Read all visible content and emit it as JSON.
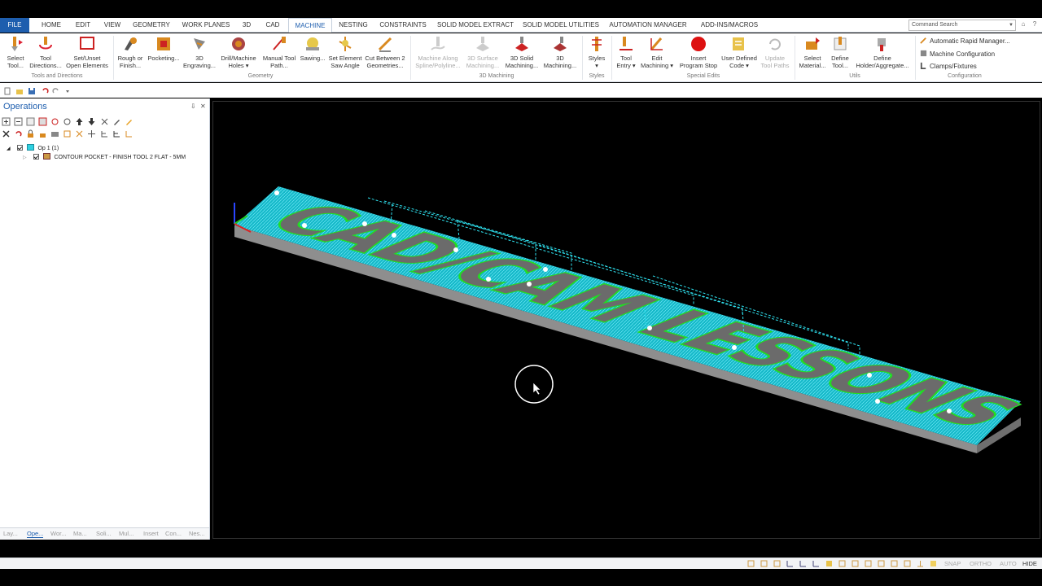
{
  "menu_tabs": [
    "FILE",
    "HOME",
    "EDIT",
    "VIEW",
    "GEOMETRY",
    "WORK PLANES",
    "3D",
    "CAD",
    "MACHINE",
    "NESTING",
    "CONSTRAINTS",
    "SOLID MODEL EXTRACT",
    "SOLID MODEL UTILITIES",
    "AUTOMATION MANAGER",
    "ADD-INS/MACROS"
  ],
  "active_tab": "MACHINE",
  "command_search": {
    "placeholder": "Command Search"
  },
  "ribbon": {
    "buttons": [
      {
        "l1": "Select",
        "l2": "Tool...",
        "icon": "select-tool-icon"
      },
      {
        "l1": "Tool",
        "l2": "Directions...",
        "icon": "tool-directions-icon"
      },
      {
        "l1": "Set/Unset",
        "l2": "Open Elements",
        "icon": "open-elements-icon"
      },
      {
        "l1": "Rough or",
        "l2": "Finish...",
        "icon": "rough-finish-icon"
      },
      {
        "l1": "Pocketing...",
        "l2": "",
        "icon": "pocketing-icon"
      },
      {
        "l1": "3D",
        "l2": "Engraving...",
        "icon": "engraving-icon"
      },
      {
        "l1": "Drill/Machine",
        "l2": "Holes ▾",
        "icon": "drill-icon"
      },
      {
        "l1": "Manual Tool",
        "l2": "Path...",
        "icon": "manual-path-icon"
      },
      {
        "l1": "Sawing...",
        "l2": "",
        "icon": "sawing-icon"
      },
      {
        "l1": "Set Element",
        "l2": "Saw Angle",
        "icon": "saw-angle-icon"
      },
      {
        "l1": "Cut Between 2",
        "l2": "Geometries...",
        "icon": "cut-between-icon"
      },
      {
        "l1": "Machine Along",
        "l2": "Spline/Polyline...",
        "icon": "machine-along-icon",
        "disabled": true
      },
      {
        "l1": "3D Surface",
        "l2": "Machining...",
        "icon": "surface-machining-icon",
        "disabled": true
      },
      {
        "l1": "3D Solid",
        "l2": "Machining...",
        "icon": "solid-machining-icon"
      },
      {
        "l1": "3D",
        "l2": "Machining...",
        "icon": "3d-machining-icon"
      },
      {
        "l1": "Styles",
        "l2": "▾",
        "icon": "styles-icon"
      },
      {
        "l1": "Tool",
        "l2": "Entry ▾",
        "icon": "tool-entry-icon"
      },
      {
        "l1": "Edit",
        "l2": "Machining ▾",
        "icon": "edit-machining-icon"
      },
      {
        "l1": "Insert",
        "l2": "Program Stop",
        "icon": "program-stop-icon"
      },
      {
        "l1": "User Defined",
        "l2": "Code ▾",
        "icon": "user-code-icon"
      },
      {
        "l1": "Update",
        "l2": "Tool Paths",
        "icon": "update-paths-icon",
        "disabled": true
      },
      {
        "l1": "Select",
        "l2": "Material...",
        "icon": "select-material-icon"
      },
      {
        "l1": "Define",
        "l2": "Tool...",
        "icon": "define-tool-icon"
      },
      {
        "l1": "Define",
        "l2": "Holder/Aggregate...",
        "icon": "define-holder-icon"
      }
    ],
    "groups": [
      "Tools and Directions",
      "Geometry",
      "3D Machining",
      "Styles",
      "Special Edits",
      "Utils",
      "Configuration"
    ],
    "config_items": [
      "Automatic Rapid Manager...",
      "Machine Configuration",
      "Clamps/Fixtures"
    ]
  },
  "panel": {
    "title": "Operations",
    "tree": [
      {
        "label": "Op 1  (1)"
      },
      {
        "label": "CONTOUR POCKET - FINISH   TOOL 2   FLAT - 5MM"
      }
    ],
    "bottom_tabs": [
      "Lay...",
      "Ope...",
      "Wor...",
      "Ma...",
      "Soli...",
      "Mul...",
      "Insert",
      "Con...",
      "Nes..."
    ],
    "active_bottom_tab": "Ope..."
  },
  "viewport": {
    "engraved_text": "CAD/CAM LESSONS"
  },
  "status": {
    "items": [
      "SNAP",
      "ORTHO",
      "AUTO",
      "HIDE"
    ]
  },
  "colors": {
    "file_tab": "#1e5eae",
    "toolpath": "#19c8d8",
    "plate": "#9a9a9a",
    "letters": "#6b6b6b",
    "finish_path": "#22dd22"
  }
}
